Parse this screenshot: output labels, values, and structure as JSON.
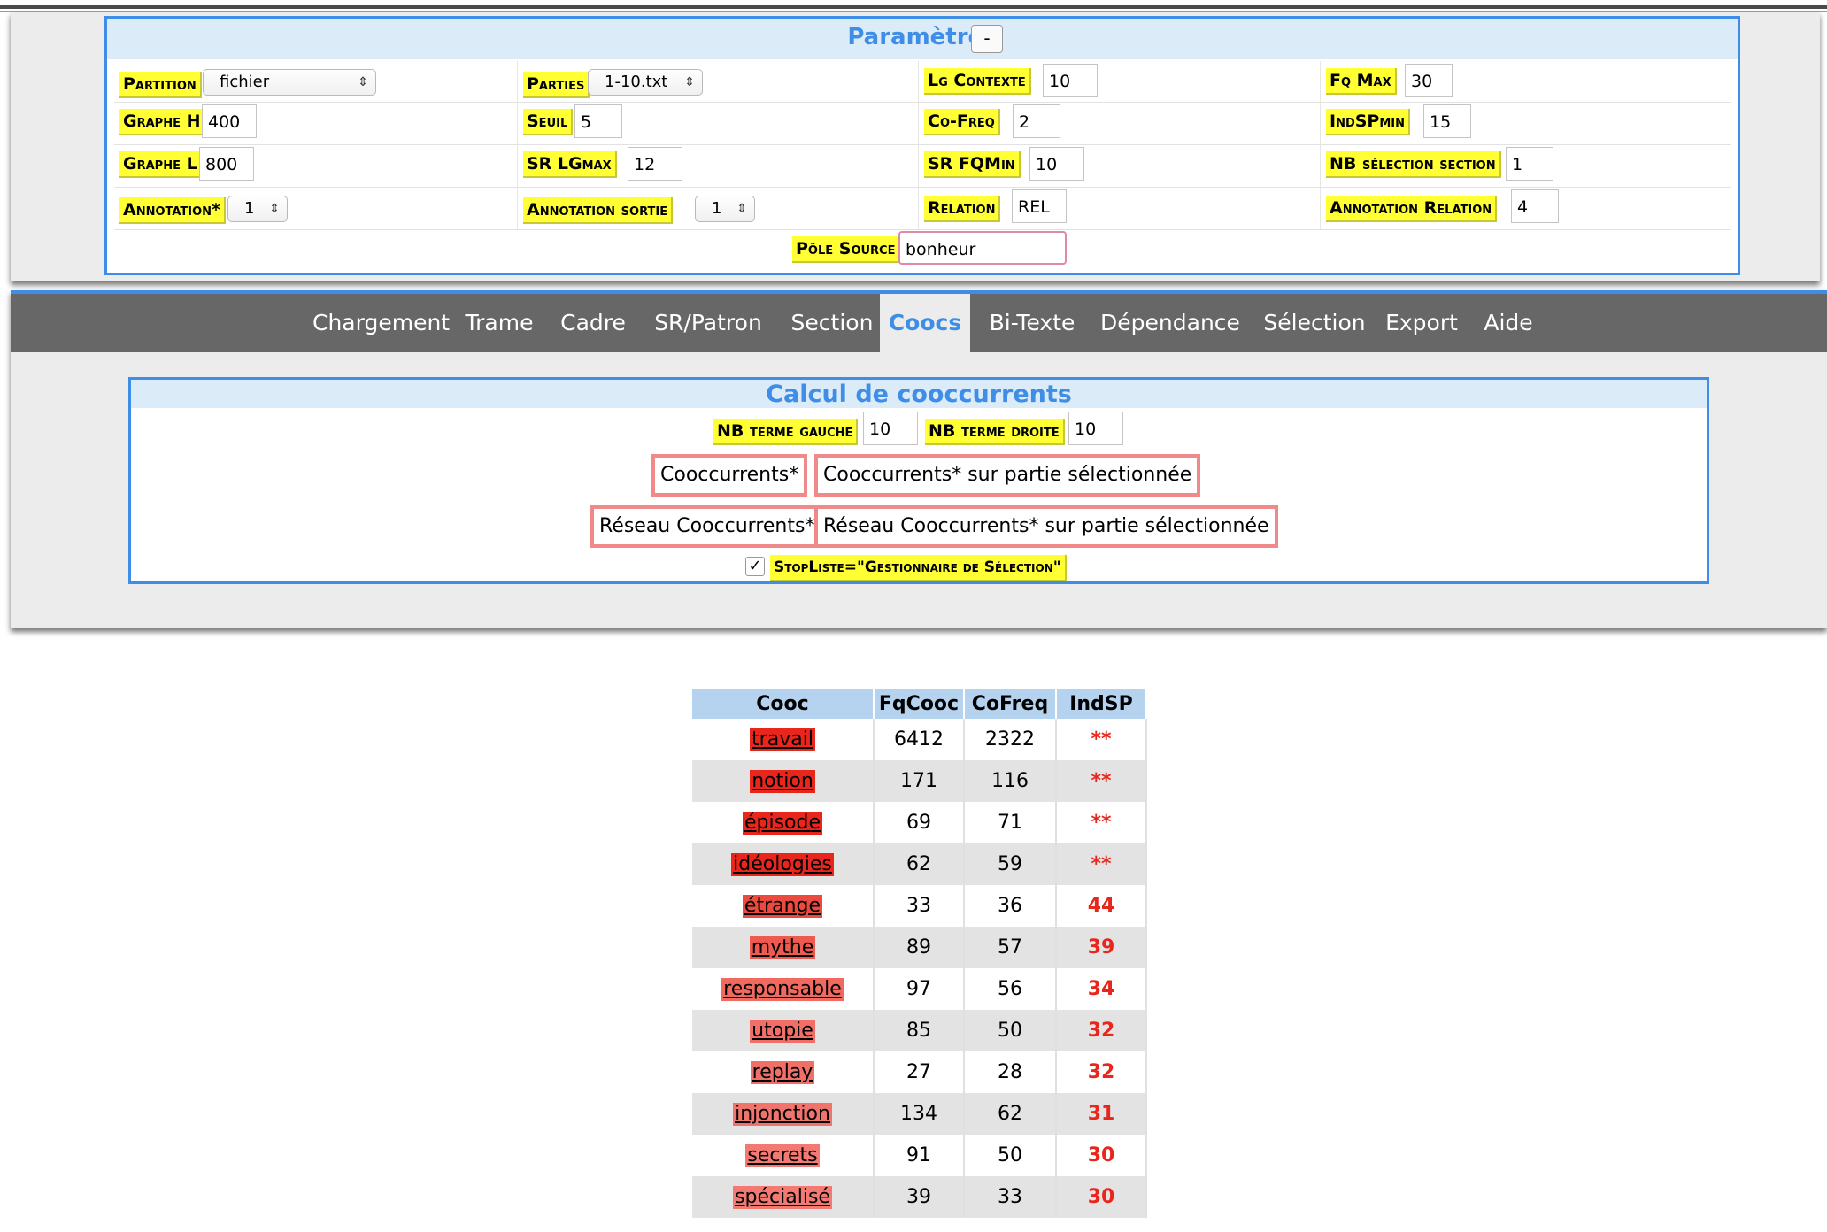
{
  "params": {
    "title": "Paramètres",
    "collapse_label": "-",
    "partition_label": "Partition",
    "partition_value": "fichier",
    "parties_label": "Parties",
    "parties_value": "1-10.txt",
    "lg_contexte_label": "Lg Contexte",
    "lg_contexte_value": "10",
    "fq_max_label": "Fq Max",
    "fq_max_value": "30",
    "graphe_h_label": "Graphe H",
    "graphe_h_value": "400",
    "seuil_label": "Seuil",
    "seuil_value": "5",
    "co_freq_label": "Co-Freq",
    "co_freq_value": "2",
    "indsp_min_label": "IndSPmin",
    "indsp_min_value": "15",
    "graphe_l_label": "Graphe L",
    "graphe_l_value": "800",
    "sr_lgmax_label": "SR LGmax",
    "sr_lgmax_value": "12",
    "sr_fqmin_label": "SR FQMin",
    "sr_fqmin_value": "10",
    "nb_selection_section_label": "NB sélection section",
    "nb_selection_section_value": "1",
    "annotation_label": "Annotation*",
    "annotation_value": "1",
    "annotation_sortie_label": "Annotation sortie",
    "annotation_sortie_value": "1",
    "relation_label": "Relation",
    "relation_value": "REL",
    "annotation_relation_label": "Annotation Relation",
    "annotation_relation_value": "4",
    "pole_source_label": "Pôle Source",
    "pole_source_value": "bonheur"
  },
  "tabs": [
    "Chargement",
    "Trame",
    "Cadre",
    "SR/Patron",
    "Section",
    "Coocs",
    "Bi-Texte",
    "Dépendance",
    "Sélection",
    "Export",
    "Aide"
  ],
  "active_tab": "Coocs",
  "cooc": {
    "title": "Calcul de cooccurrents",
    "nb_terme_gauche_label": "NB terme gauche",
    "nb_terme_gauche_value": "10",
    "nb_terme_droite_label": "NB terme droite",
    "nb_terme_droite_value": "10",
    "btn_cooccurrents": "Cooccurrents*",
    "btn_cooccurrents_partie": "Cooccurrents* sur partie sélectionnée",
    "btn_reseau": "Réseau Cooccurrents*",
    "btn_reseau_partie": "Réseau Cooccurrents* sur partie sélectionnée",
    "stopliste_label": "StopListe=\"Gestionnaire de Sélection\"",
    "stopliste_checked": "✓"
  },
  "table": {
    "headers": [
      "Cooc",
      "FqCooc",
      "CoFreq",
      "IndSP"
    ],
    "rows": [
      {
        "cooc": "travail",
        "fq": "6412",
        "cofreq": "2322",
        "indsp": "**",
        "color": "#e8261c"
      },
      {
        "cooc": "notion",
        "fq": "171",
        "cofreq": "116",
        "indsp": "**",
        "color": "#e8261c"
      },
      {
        "cooc": "épisode",
        "fq": "69",
        "cofreq": "71",
        "indsp": "**",
        "color": "#e8261c"
      },
      {
        "cooc": "idéologies",
        "fq": "62",
        "cofreq": "59",
        "indsp": "**",
        "color": "#e8261c"
      },
      {
        "cooc": "étrange",
        "fq": "33",
        "cofreq": "36",
        "indsp": "44",
        "color": "#ec4a3e"
      },
      {
        "cooc": "mythe",
        "fq": "89",
        "cofreq": "57",
        "indsp": "39",
        "color": "#ee5a50"
      },
      {
        "cooc": "responsable",
        "fq": "97",
        "cofreq": "56",
        "indsp": "34",
        "color": "#f06a60"
      },
      {
        "cooc": "utopie",
        "fq": "85",
        "cofreq": "50",
        "indsp": "32",
        "color": "#f07068"
      },
      {
        "cooc": "replay",
        "fq": "27",
        "cofreq": "28",
        "indsp": "32",
        "color": "#f07068"
      },
      {
        "cooc": "injonction",
        "fq": "134",
        "cofreq": "62",
        "indsp": "31",
        "color": "#f0746c"
      },
      {
        "cooc": "secrets",
        "fq": "91",
        "cofreq": "50",
        "indsp": "30",
        "color": "#f27a72"
      },
      {
        "cooc": "spécialisé",
        "fq": "39",
        "cofreq": "33",
        "indsp": "30",
        "color": "#f27a72"
      }
    ]
  }
}
